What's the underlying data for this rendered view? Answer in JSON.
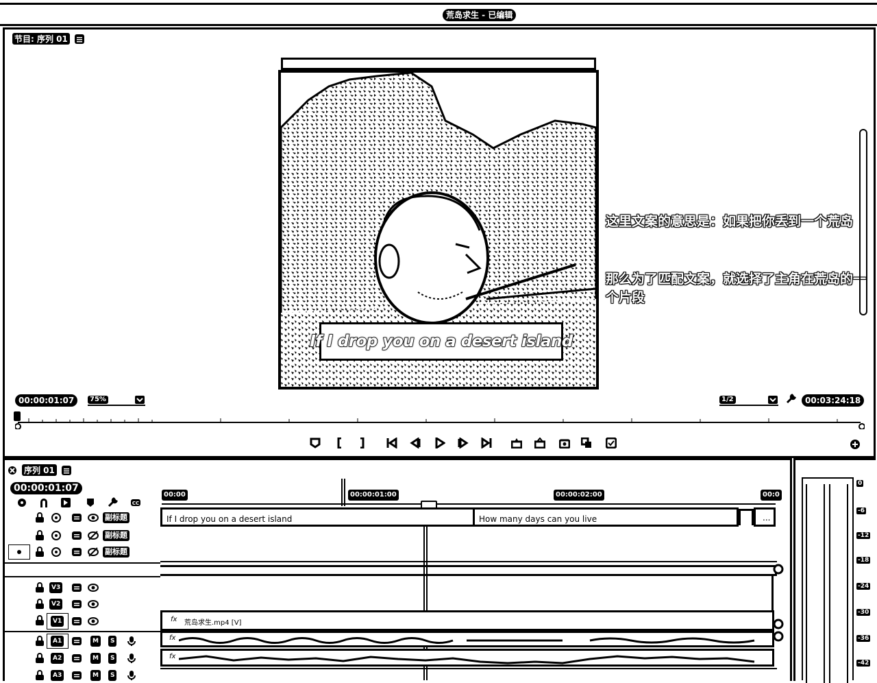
{
  "window": {
    "title": "荒岛求生 - 已编辑"
  },
  "program_monitor": {
    "tab_label": "节目: 序列 01",
    "timecode_current": "00:00:01:07",
    "zoom": "75%",
    "resolution": "1/2",
    "timecode_duration": "00:03:24:18",
    "subtitle_overlay": "If I drop you on a desert island"
  },
  "annotation": {
    "line1": "这里文案的意思是：如果把你丢到一个荒岛",
    "line2": "那么为了匹配文案，就选择了主角在荒岛的一个片段"
  },
  "timeline": {
    "tab_label": "序列 01",
    "timecode": "00:00:01:07",
    "ruler": [
      "00:00",
      "00:00:01:00",
      "00:00:02:00",
      "00:0"
    ],
    "caption_tracks": [
      {
        "label": "副标题"
      },
      {
        "label": "副标题"
      },
      {
        "label": "副标题"
      }
    ],
    "video_tracks": [
      {
        "label": "V3"
      },
      {
        "label": "V2"
      },
      {
        "label": "V1"
      }
    ],
    "audio_tracks": [
      {
        "label": "A1",
        "m": "M",
        "s": "S"
      },
      {
        "label": "A2",
        "m": "M",
        "s": "S"
      },
      {
        "label": "A3",
        "m": "M",
        "s": "S"
      }
    ],
    "caption_clips": [
      "If I drop you on a desert island",
      "How many days can you live",
      "..."
    ],
    "video_clip": "荒岛求生.mp4 [V]",
    "audio_fx": [
      "fx",
      "fx"
    ],
    "clip_fx": "fx"
  },
  "meter": {
    "labels": [
      "0",
      "-6",
      "-12",
      "-18",
      "-24",
      "-30",
      "-36",
      "-42"
    ]
  },
  "colors": {
    "bg": "#ffffff",
    "ink": "#000000"
  }
}
